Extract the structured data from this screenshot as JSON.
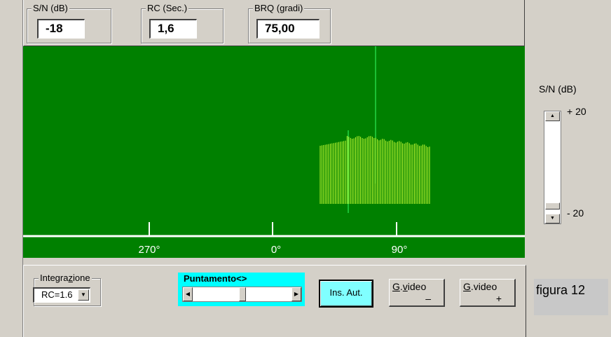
{
  "top": {
    "sn": {
      "label": "S/N (dB)",
      "value": "-18"
    },
    "rc": {
      "label": "RC (Sec.)",
      "value": "1,6"
    },
    "brq": {
      "label": "BRQ (gradi)",
      "value": "75,00"
    }
  },
  "scope": {
    "ticks": [
      "270°",
      "0°",
      "90°"
    ],
    "colors": {
      "background": "#008000",
      "signal": "#ccff33",
      "axis": "#ffffff",
      "marker": "#33ff66"
    }
  },
  "controls": {
    "integrazione": {
      "label_pre": "Integra",
      "label_u": "z",
      "label_post": "ione",
      "value": "RC=1.6"
    },
    "puntamento": {
      "label": "Puntamento<>",
      "position": 0.5
    },
    "ins_aut": "Ins. Aut.",
    "gvideo_minus": {
      "u": "G",
      "mid": ".",
      "u2": "v",
      "rest": "ideo",
      "sign": "–"
    },
    "gvideo_plus": {
      "u": "G",
      "rest": ".video",
      "sign": "+"
    }
  },
  "side": {
    "label": "S/N (dB)",
    "max": "+ 20",
    "min": "- 20",
    "level": 0.95
  },
  "figure": "figura 12"
}
